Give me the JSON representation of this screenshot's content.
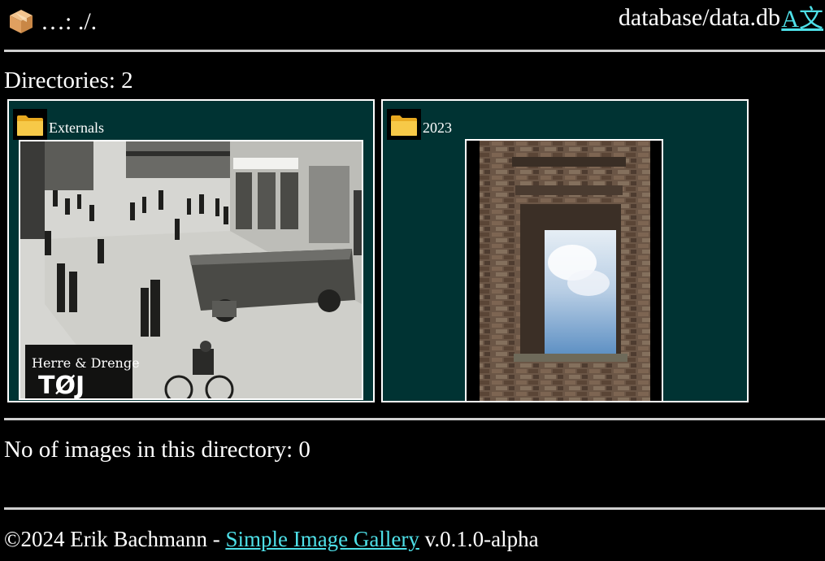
{
  "header": {
    "breadcrumb": "…: ./.",
    "db_path": "database/data.db",
    "language_link": "A文",
    "logo_icon": "box-icon"
  },
  "directories": {
    "heading": "Directories: 2",
    "items": [
      {
        "label": "Externals",
        "icon": "folder-icon",
        "thumbnail": "black-and-white street photo with overturned truck"
      },
      {
        "label": "2023",
        "icon": "folder-icon",
        "thumbnail": "ruined brick window with sky"
      }
    ]
  },
  "images": {
    "count_text": "No of images in this directory: 0"
  },
  "footer": {
    "prefix": "©2024 Erik Bachmann - ",
    "link_text": "Simple Image Gallery",
    "suffix": " v.0.1.0-alpha"
  },
  "colors": {
    "background": "#000000",
    "card_background": "#003333",
    "link": "#4ee0e8",
    "separator": "#cfcfcf",
    "folder": "#f7c948"
  }
}
